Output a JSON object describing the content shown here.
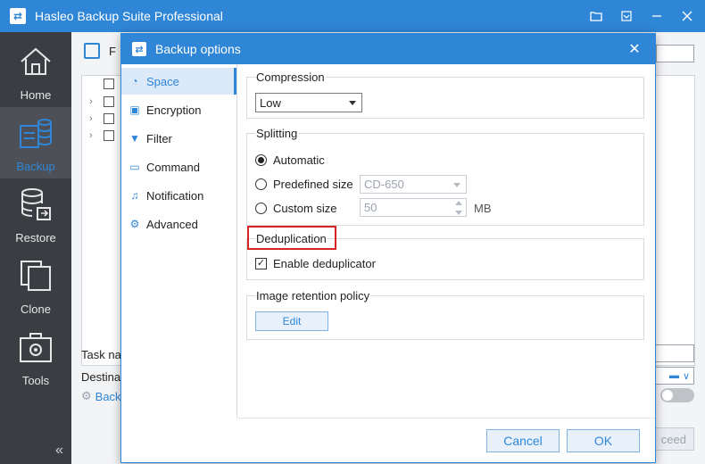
{
  "app": {
    "title": "Hasleo Backup Suite Professional",
    "accent": "#2f86d6",
    "sidebar_bg": "#3a3d41"
  },
  "sidebar": {
    "items": [
      {
        "label": "Home",
        "icon": "home-icon"
      },
      {
        "label": "Backup",
        "icon": "backup-icon",
        "active": true
      },
      {
        "label": "Restore",
        "icon": "restore-icon"
      },
      {
        "label": "Clone",
        "icon": "clone-icon"
      },
      {
        "label": "Tools",
        "icon": "tools-icon"
      }
    ],
    "collapse_glyph": "«"
  },
  "background": {
    "header_label": "F",
    "task_name_label": "Task na",
    "destination_label": "Destinat",
    "back_link_label": "Back",
    "proceed_label": "ceed"
  },
  "dialog": {
    "title": "Backup options",
    "close_glyph": "✕",
    "nav": [
      {
        "label": "Space",
        "icon": "space-icon",
        "active": true
      },
      {
        "label": "Encryption",
        "icon": "lock-icon"
      },
      {
        "label": "Filter",
        "icon": "filter-icon"
      },
      {
        "label": "Command",
        "icon": "command-icon"
      },
      {
        "label": "Notification",
        "icon": "bell-icon"
      },
      {
        "label": "Advanced",
        "icon": "gear-icon"
      }
    ],
    "compression": {
      "title": "Compression",
      "value": "Low"
    },
    "splitting": {
      "title": "Splitting",
      "automatic_label": "Automatic",
      "predefined_label": "Predefined size",
      "predefined_value": "CD-650",
      "custom_label": "Custom size",
      "custom_value": "50",
      "unit": "MB",
      "selected": "automatic"
    },
    "deduplication": {
      "title": "Deduplication",
      "enable_label": "Enable deduplicator",
      "checked": true,
      "highlight_color": "#d62424"
    },
    "retention": {
      "title": "Image retention policy",
      "edit_label": "Edit"
    },
    "buttons": {
      "cancel": "Cancel",
      "ok": "OK"
    }
  }
}
